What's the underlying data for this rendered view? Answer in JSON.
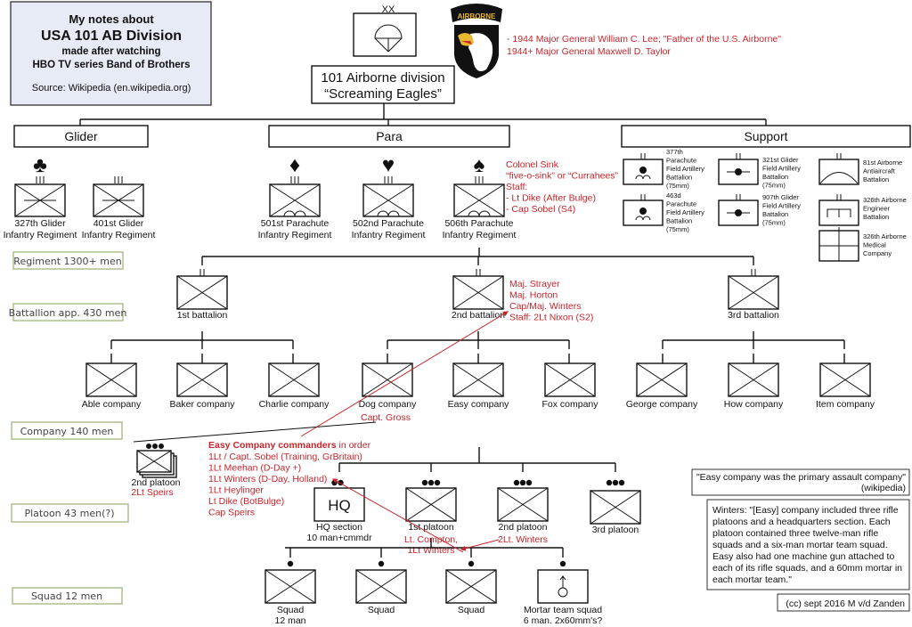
{
  "title_box": {
    "line1": "My notes about",
    "line2": "USA 101 AB Division",
    "line3": "made after watching",
    "line4": "HBO TV series Band of Brothers",
    "source": "Source: Wikipedia (en.wikipedia.org)"
  },
  "division": {
    "echelon": "XX",
    "name": "101 Airborne division",
    "nickname": "“Screaming Eagles”",
    "patch_tab": "AIRBORNE",
    "commanders": [
      "- 1944 Major General William C. Lee;  \"Father of the U.S. Airborne\"",
      "1944+ Major General Maxwell D. Taylor"
    ]
  },
  "groups": {
    "glider": "Glider",
    "para": "Para",
    "support": "Support"
  },
  "regiments": [
    {
      "suit": "♣",
      "line1": "327th Glider",
      "line2": "Infantry Regiment",
      "type": "glider"
    },
    {
      "suit": "",
      "line1": "401st Glider",
      "line2": "Infantry Regiment",
      "type": "glider"
    },
    {
      "suit": "♦",
      "line1": "501st Parachute",
      "line2": "Infantry Regiment",
      "type": "para"
    },
    {
      "suit": "♥",
      "line1": "502nd Parachute",
      "line2": "Infantry Regiment",
      "type": "para"
    },
    {
      "suit": "♠",
      "line1": "506th Parachute",
      "line2": "Infantry Regiment",
      "type": "para"
    }
  ],
  "regiment_506_notes": [
    "Colonel Sink",
    "“five-o-sink” or “Currahees”",
    "Staff:",
    "- Lt Dike (After Bulge)",
    "- Cap Sobel (S4)"
  ],
  "support_units": [
    {
      "lines": [
        "377th",
        "Parachute",
        "Field Artillery",
        "Battalion",
        "(75mm)"
      ],
      "symbol": "para-artillery"
    },
    {
      "lines": [
        "463d",
        "Parachute",
        "Field Artillery",
        "Battalion",
        "(75mm)"
      ],
      "symbol": "para-artillery"
    },
    {
      "lines": [
        "321st Glider",
        "Field Artillery",
        "Battalion",
        "(75mm)"
      ],
      "symbol": "glider-artillery"
    },
    {
      "lines": [
        "907th Glider",
        "Field Artillery",
        "Battalion",
        "(75mm)"
      ],
      "symbol": "glider-artillery"
    },
    {
      "lines": [
        "81st Airborne",
        "Antiaircraft",
        "Battalion"
      ],
      "symbol": "antiaircraft"
    },
    {
      "lines": [
        "326th Airborne",
        "Engineer",
        "Battalion"
      ],
      "symbol": "engineer"
    },
    {
      "lines": [
        "326th Airborne",
        "Medical",
        "Company"
      ],
      "symbol": "medical"
    }
  ],
  "size_labels": {
    "regiment": "Regiment 1300+ men",
    "battalion": "Battallion app. 430 men",
    "company": "Company 140 men",
    "platoon": "Platoon 43 men(?)",
    "squad": "Squad 12 men"
  },
  "battalions": [
    {
      "label": "1st battalion"
    },
    {
      "label": "2nd battalion"
    },
    {
      "label": "3rd battalion"
    }
  ],
  "battalion_2_notes": [
    "Maj. Strayer",
    "Maj. Horton",
    "Cap/Maj. Winters",
    "Staff: 2Lt Nixon (S2)"
  ],
  "companies": [
    "Able company",
    "Baker company",
    "Charlie company",
    "Dog company",
    "Easy company",
    "Fox company",
    "George company",
    "How company",
    "Item company"
  ],
  "dog_company_note": "Capt. Gross",
  "dog_platoon": {
    "label": "2nd platoon",
    "leader": "2Lt Speirs"
  },
  "easy_commanders": {
    "heading_bold": "Easy Company commanders",
    "heading_rest": " in order",
    "list": [
      "1Lt / Capt. Sobel (Training, GrBritain)",
      "1Lt Meehan (D-Day +)",
      "1Lt Winters (D-Day, Holland)",
      "1Lt Heylinger",
      "Lt Dike (BotBulge)",
      "Cap Speirs"
    ]
  },
  "platoons": [
    {
      "label": "HQ section",
      "sub": "10 man+cmmdr",
      "box_text": "HQ"
    },
    {
      "label": "1st platoon",
      "note1": "Lt. Compton,",
      "note2": "1Lt Winters"
    },
    {
      "label": "2nd platoon",
      "note1": "2Lt. Winters"
    },
    {
      "label": "3rd platoon"
    }
  ],
  "squads": [
    {
      "label": "Squad",
      "sub": "12 man"
    },
    {
      "label": "Squad"
    },
    {
      "label": "Squad"
    },
    {
      "label": "Mortar team squad",
      "sub": "6 man. 2x60mm's?"
    }
  ],
  "quote_box": {
    "line1": "\"Easy company was the primary assault company\"",
    "line2": "(wikipedia)"
  },
  "winters_quote": [
    "Winters: \"[Easy] company included three rifle",
    "platoons and a headquarters section. Each",
    "platoon contained three twelve-man rifle",
    "squads and a six-man mortar team squad.",
    "Easy also had one machine gun attached to",
    "each of its rifle squads, and a 60mm mortar in",
    "each mortar team.\""
  ],
  "credit": "(cc) sept 2016 M v/d Zanden",
  "colors": {
    "annotation_red": "#c8252c",
    "title_bg": "#e6ebf5",
    "size_label_border": "#98b070"
  }
}
